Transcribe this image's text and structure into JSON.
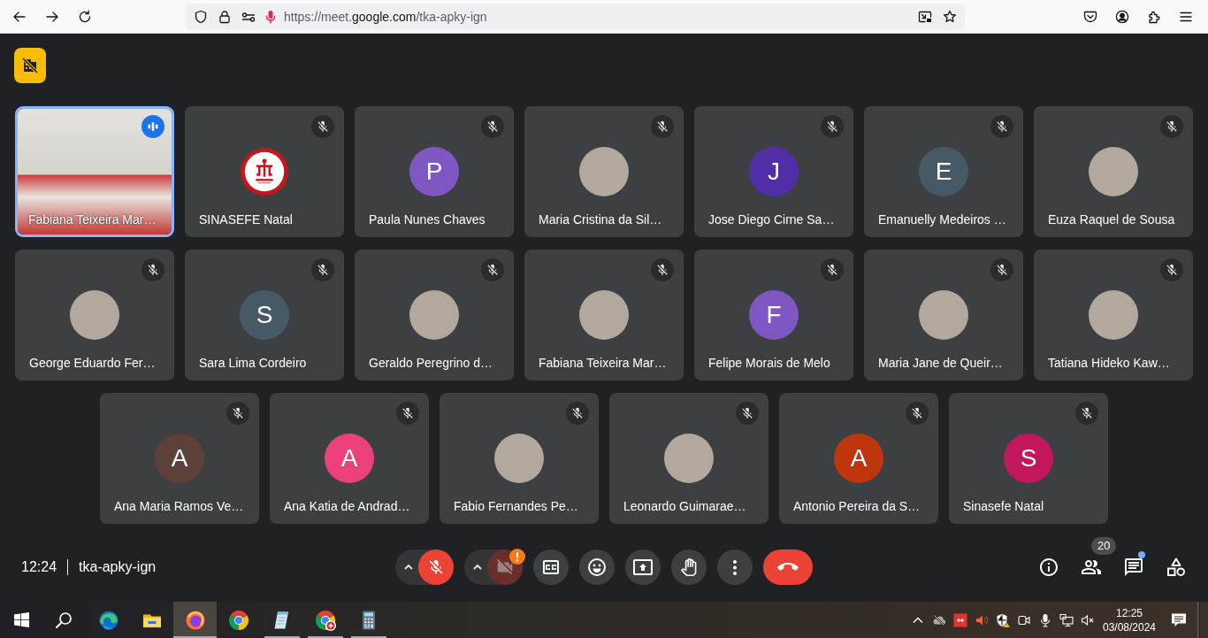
{
  "browser": {
    "url": "https://meet.**google.com**/tka-apky-ign"
  },
  "participants": [
    {
      "name": "Fabiana Teixeira Mar…",
      "kind": "video",
      "muted": false,
      "speaking": true
    },
    {
      "name": "SINASEFE Natal",
      "kind": "logo",
      "muted": true,
      "speaking": false
    },
    {
      "name": "Paula Nunes Chaves",
      "kind": "initial",
      "initial": "P",
      "color": "#7e57c2",
      "muted": true,
      "speaking": false
    },
    {
      "name": "Maria Cristina da Sil…",
      "kind": "photo",
      "muted": true,
      "speaking": false
    },
    {
      "name": "Jose Diego Cirne Sa…",
      "kind": "initial",
      "initial": "J",
      "color": "#512da8",
      "muted": true,
      "speaking": false
    },
    {
      "name": "Emanuelly Medeiros …",
      "kind": "initial",
      "initial": "E",
      "color": "#455a64",
      "muted": true,
      "speaking": false
    },
    {
      "name": "Euza Raquel de Sousa",
      "kind": "photo",
      "muted": true,
      "speaking": false
    },
    {
      "name": "George Eduardo Fer…",
      "kind": "photo",
      "muted": true,
      "speaking": false
    },
    {
      "name": "Sara Lima Cordeiro",
      "kind": "initial",
      "initial": "S",
      "color": "#455a64",
      "muted": true,
      "speaking": false
    },
    {
      "name": "Geraldo Peregrino d…",
      "kind": "photo",
      "muted": true,
      "speaking": false
    },
    {
      "name": "Fabiana Teixeira Mar…",
      "kind": "photo",
      "muted": true,
      "speaking": false
    },
    {
      "name": "Felipe Morais de Melo",
      "kind": "initial",
      "initial": "F",
      "color": "#7e57c2",
      "muted": true,
      "speaking": false
    },
    {
      "name": "Maria Jane de Queir…",
      "kind": "photo",
      "muted": true,
      "speaking": false
    },
    {
      "name": "Tatiana Hideko Kaw…",
      "kind": "photo",
      "muted": true,
      "speaking": false
    },
    {
      "name": "Ana Maria Ramos Ve…",
      "kind": "initial",
      "initial": "A",
      "color": "#5d4037",
      "muted": true,
      "speaking": false
    },
    {
      "name": "Ana Katia de Andrad…",
      "kind": "initial",
      "initial": "A",
      "color": "#ec407a",
      "muted": true,
      "speaking": false
    },
    {
      "name": "Fabio Fernandes Pe…",
      "kind": "photo",
      "muted": true,
      "speaking": false
    },
    {
      "name": "Leonardo Guimarae…",
      "kind": "photo",
      "muted": true,
      "speaking": false
    },
    {
      "name": "Antonio Pereira da S…",
      "kind": "initial",
      "initial": "A",
      "color": "#bf360c",
      "muted": true,
      "speaking": false
    },
    {
      "name": "Sinasefe Natal",
      "kind": "initial",
      "initial": "S",
      "color": "#c2185b",
      "muted": true,
      "speaking": false
    }
  ],
  "meeting": {
    "time": "12:24",
    "code": "tka-apky-ign"
  },
  "controls": {
    "mic_on": false,
    "camera_on": false,
    "camera_alert": true
  },
  "side_buttons": {
    "people_count": "20",
    "chat_unread": true
  },
  "taskbar": {
    "apps": [
      {
        "kind": "edge",
        "open": false,
        "selected": false
      },
      {
        "kind": "files",
        "open": false,
        "selected": false
      },
      {
        "kind": "firefox",
        "open": true,
        "selected": true
      },
      {
        "kind": "chrome",
        "open": false,
        "selected": false
      },
      {
        "kind": "notes",
        "open": true,
        "selected": false
      },
      {
        "kind": "chrome-badge",
        "open": true,
        "selected": false
      },
      {
        "kind": "calculator",
        "open": true,
        "selected": false
      }
    ],
    "clock": {
      "time": "12:25",
      "date": "03/08/2024"
    }
  }
}
